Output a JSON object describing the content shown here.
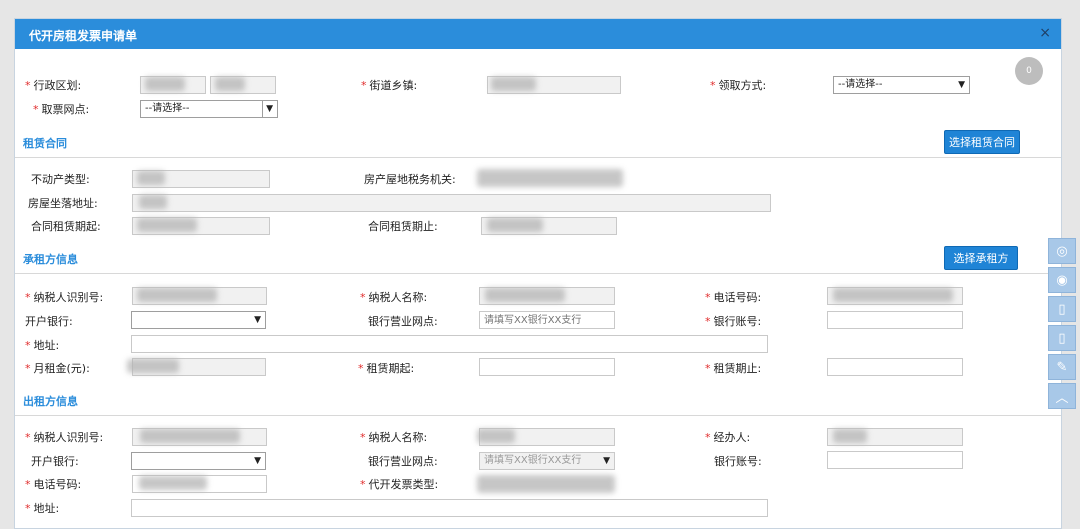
{
  "dialog": {
    "title": "代开房租发票申请单",
    "close": "×"
  },
  "avatar": "0",
  "top": {
    "district_label": "行政区划:",
    "street_label": "街道乡镇:",
    "pickup_label": "领取方式:",
    "pickup_value": "--请选择--",
    "ticket_point_label": "取票网点:",
    "ticket_point_value": "--请选择--"
  },
  "lease": {
    "section": "租赁合同",
    "select_button": "选择租赁合同",
    "property_type_label": "不动产类型:",
    "tax_office_label": "房产屋地税务机关:",
    "address_label": "房屋坐落地址:",
    "start_label": "合同租赁期起:",
    "end_label": "合同租赁期止:"
  },
  "tenant": {
    "section": "承租方信息",
    "select_button": "选择承租方",
    "taxpayer_id_label": "纳税人识别号:",
    "taxpayer_name_label": "纳税人名称:",
    "phone_label": "电话号码:",
    "bank_label": "开户银行:",
    "branch_label": "银行营业网点:",
    "branch_placeholder": "请填写XX银行XX支行",
    "account_label": "银行账号:",
    "address_label": "地址:",
    "rent_label": "月租金(元):",
    "rent_start_label": "租赁期起:",
    "rent_end_label": "租赁期止:"
  },
  "lessor": {
    "section": "出租方信息",
    "taxpayer_id_label": "纳税人识别号:",
    "taxpayer_name_label": "纳税人名称:",
    "agent_label": "经办人:",
    "bank_label": "开户银行:",
    "branch_label": "银行营业网点:",
    "branch_placeholder": "请填写XX银行XX支行",
    "account_label": "银行账号:",
    "phone_label": "电话号码:",
    "invoice_type_label": "代开发票类型:",
    "address_label": "地址:"
  },
  "sidebar_icons": [
    "wechat-icon",
    "weibo-icon",
    "mobile-icon",
    "tablet-icon",
    "edit-icon",
    "up-arrow-icon"
  ]
}
